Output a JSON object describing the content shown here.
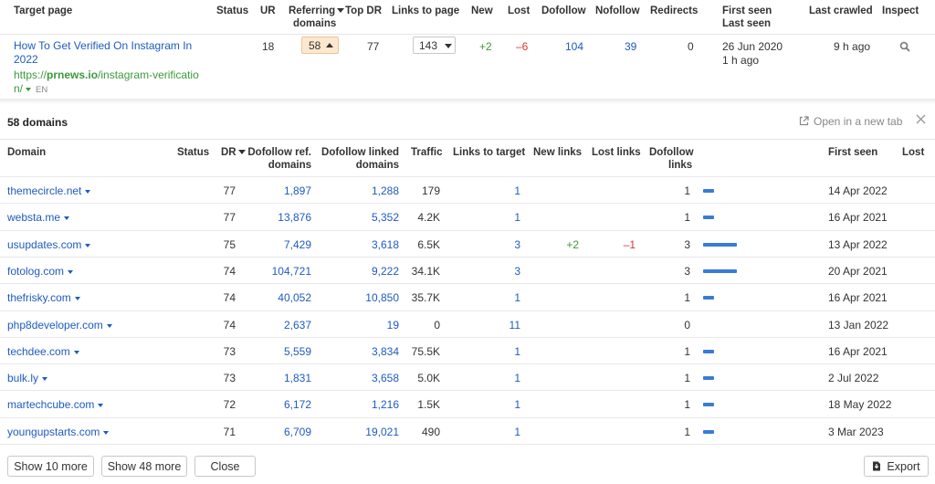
{
  "top_table": {
    "headers": {
      "target_page": "Target page",
      "status": "Status",
      "ur": "UR",
      "referring_domains_1": "Referring",
      "referring_domains_2": "domains",
      "top_dr": "Top DR",
      "links_to_page": "Links to page",
      "new": "New",
      "lost": "Lost",
      "dofollow": "Dofollow",
      "nofollow": "Nofollow",
      "redirects": "Redirects",
      "first_seen": "First seen",
      "last_seen": "Last seen",
      "last_crawled": "Last crawled",
      "inspect": "Inspect"
    },
    "row": {
      "title_1": "How To Get Verified On Instagram In",
      "title_2": "2022",
      "url_prefix": "https://",
      "url_domain": "prnews.io",
      "url_path_1": "/instagram-verificatio",
      "url_path_2": "n/",
      "lang": "EN",
      "ur": "18",
      "referring_domains": "58",
      "top_dr": "77",
      "links_to_page": "143",
      "new": "+2",
      "lost": "–6",
      "dofollow": "104",
      "nofollow": "39",
      "redirects": "0",
      "first_seen": "26 Jun 2020",
      "last_seen": "1 h ago",
      "last_crawled": "9 h ago"
    }
  },
  "panel": {
    "title": "58 domains",
    "open_new_tab": "Open in a new tab",
    "headers": {
      "domain": "Domain",
      "status": "Status",
      "dr": "DR",
      "dofollow_ref_1": "Dofollow ref.",
      "dofollow_ref_2": "domains",
      "dofollow_linked_1": "Dofollow linked",
      "dofollow_linked_2": "domains",
      "traffic": "Traffic",
      "links_to_target": "Links to target",
      "new_links": "New links",
      "lost_links": "Lost links",
      "dofollow_links_1": "Dofollow",
      "dofollow_links_2": "links",
      "first_seen": "First seen",
      "lost": "Lost"
    },
    "rows": [
      {
        "domain": "themecircle.net",
        "dr": "77",
        "dofollow_ref": "1,897",
        "dofollow_linked": "1,288",
        "traffic": "179",
        "links_to_target": "1",
        "new_links": "",
        "lost_links": "",
        "dofollow_links": "1",
        "bar": 1,
        "first_seen": "14 Apr 2022"
      },
      {
        "domain": "websta.me",
        "dr": "77",
        "dofollow_ref": "13,876",
        "dofollow_linked": "5,352",
        "traffic": "4.2K",
        "links_to_target": "1",
        "new_links": "",
        "lost_links": "",
        "dofollow_links": "1",
        "bar": 1,
        "first_seen": "16 Apr 2021"
      },
      {
        "domain": "usupdates.com",
        "dr": "75",
        "dofollow_ref": "7,429",
        "dofollow_linked": "3,618",
        "traffic": "6.5K",
        "links_to_target": "3",
        "new_links": "+2",
        "lost_links": "–1",
        "dofollow_links": "3",
        "bar": 3,
        "first_seen": "13 Apr 2022"
      },
      {
        "domain": "fotolog.com",
        "dr": "74",
        "dofollow_ref": "104,721",
        "dofollow_linked": "9,222",
        "traffic": "34.1K",
        "links_to_target": "3",
        "new_links": "",
        "lost_links": "",
        "dofollow_links": "3",
        "bar": 3,
        "first_seen": "20 Apr 2021"
      },
      {
        "domain": "thefrisky.com",
        "dr": "74",
        "dofollow_ref": "40,052",
        "dofollow_linked": "10,850",
        "traffic": "35.7K",
        "links_to_target": "1",
        "new_links": "",
        "lost_links": "",
        "dofollow_links": "1",
        "bar": 1,
        "first_seen": "16 Apr 2021"
      },
      {
        "domain": "php8developer.com",
        "dr": "74",
        "dofollow_ref": "2,637",
        "dofollow_linked": "19",
        "traffic": "0",
        "links_to_target": "11",
        "new_links": "",
        "lost_links": "",
        "dofollow_links": "0",
        "bar": 0,
        "first_seen": "13 Jan 2022"
      },
      {
        "domain": "techdee.com",
        "dr": "73",
        "dofollow_ref": "5,559",
        "dofollow_linked": "3,834",
        "traffic": "75.5K",
        "links_to_target": "1",
        "new_links": "",
        "lost_links": "",
        "dofollow_links": "1",
        "bar": 1,
        "first_seen": "16 Apr 2021"
      },
      {
        "domain": "bulk.ly",
        "dr": "73",
        "dofollow_ref": "1,831",
        "dofollow_linked": "3,658",
        "traffic": "5.0K",
        "links_to_target": "1",
        "new_links": "",
        "lost_links": "",
        "dofollow_links": "1",
        "bar": 1,
        "first_seen": "2 Jul 2022"
      },
      {
        "domain": "martechcube.com",
        "dr": "72",
        "dofollow_ref": "6,172",
        "dofollow_linked": "1,216",
        "traffic": "1.5K",
        "links_to_target": "1",
        "new_links": "",
        "lost_links": "",
        "dofollow_links": "1",
        "bar": 1,
        "first_seen": "18 May 2022"
      },
      {
        "domain": "youngupstarts.com",
        "dr": "71",
        "dofollow_ref": "6,709",
        "dofollow_linked": "19,021",
        "traffic": "490",
        "links_to_target": "1",
        "new_links": "",
        "lost_links": "",
        "dofollow_links": "1",
        "bar": 1,
        "first_seen": "3 Mar 2023"
      }
    ],
    "buttons": {
      "show_10": "Show 10 more",
      "show_48": "Show 48 more",
      "close": "Close",
      "export": "Export"
    }
  },
  "colors": {
    "link": "#1f5bbf",
    "positive": "#3a9a3a",
    "negative": "#d9382f",
    "bar": "#3a7bd5",
    "badge_bg": "#fde8cf"
  }
}
